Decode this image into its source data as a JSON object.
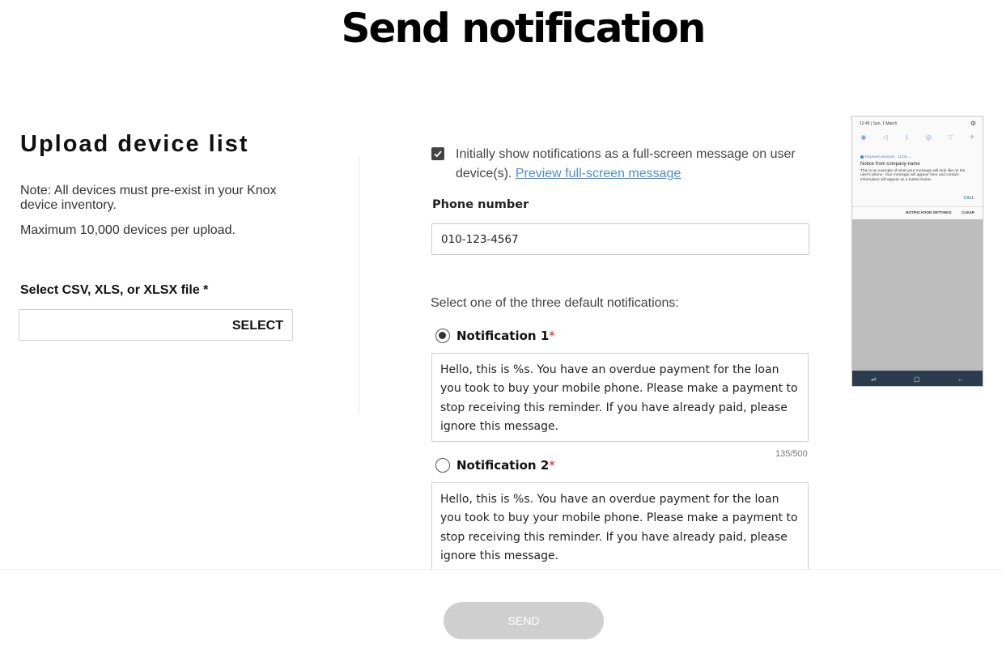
{
  "page": {
    "title": "Send notification"
  },
  "upload": {
    "title": "Upload device list",
    "note": "Note: All devices must pre-exist in your Knox device inventory.",
    "max_note": "Maximum 10,000 devices per upload.",
    "file_label": "Select CSV, XLS, or XLSX file *",
    "select_label": "SELECT"
  },
  "fullscreen": {
    "checked": true,
    "text": "Initially show notifications as a full-screen message on user device(s).",
    "preview_link": "Preview full-screen message"
  },
  "phone": {
    "label": "Phone number",
    "value": "010-123-4567"
  },
  "defaults": {
    "prompt": "Select one of the three default notifications:",
    "required_mark": "*",
    "items": [
      {
        "label": "Notification 1",
        "selected": true,
        "message": "Hello, this is %s. You have an overdue payment for the loan you took to buy your mobile phone. Please make a payment to stop receiving this reminder. If you have already paid, please ignore this message.",
        "counter": "135/500"
      },
      {
        "label": "Notification 2",
        "selected": false,
        "message": "Hello, this is %s. You have an overdue payment for the loan you took to buy your mobile phone. Please make a payment to stop receiving this reminder. If you have already paid, please ignore this message."
      }
    ]
  },
  "preview": {
    "time": "12:45 | Sun, 1 March",
    "app_name": "Payment Services · 11:35 ⌄",
    "notice_title": "Notice from company-name",
    "notice_body": "This is an example of what your message will look like on the user's phone. Your message will appear here and contact information will appear as a button below.",
    "call_label": "CALL",
    "settings_label": "NOTIFICATION SETTINGS",
    "clear_label": "CLEAR",
    "icons": [
      "wifi-icon",
      "mute-icon",
      "bluetooth-icon",
      "nfc-icon",
      "flashlight-icon",
      "airplane-icon"
    ],
    "nav_icons": [
      "recents-icon",
      "home-icon",
      "back-icon"
    ]
  },
  "footer": {
    "send_label": "SEND"
  },
  "colors": {
    "link": "#4a8edb",
    "required": "#d92020",
    "send_disabled": "#cfcfcf",
    "phone_nav": "#2c3b4d"
  }
}
